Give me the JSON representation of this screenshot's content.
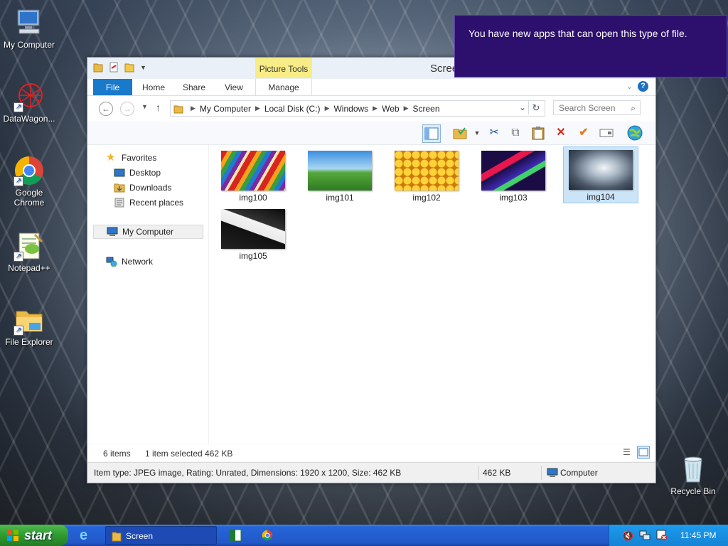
{
  "desktop": {
    "icons": [
      {
        "label": "My Computer"
      },
      {
        "label": "DataWagon..."
      },
      {
        "label": "Google Chrome"
      },
      {
        "label": "Notepad++"
      },
      {
        "label": "File Explorer"
      },
      {
        "label": "Recycle Bin"
      }
    ]
  },
  "window": {
    "title": "Screen",
    "context_tab": "Picture Tools",
    "tabs": [
      "File",
      "Home",
      "Share",
      "View",
      "Manage"
    ],
    "help": "?",
    "address": {
      "segments": [
        "My Computer",
        "Local Disk (C:)",
        "Windows",
        "Web",
        "Screen"
      ]
    },
    "search_placeholder": "Search Screen",
    "nav": {
      "favorites": "Favorites",
      "desktop": "Desktop",
      "downloads": "Downloads",
      "recent": "Recent places",
      "computer": "My Computer",
      "network": "Network"
    },
    "files": [
      {
        "name": "img100"
      },
      {
        "name": "img101"
      },
      {
        "name": "img102"
      },
      {
        "name": "img103"
      },
      {
        "name": "img104"
      },
      {
        "name": "img105"
      }
    ],
    "status": {
      "count": "6 items",
      "selection": "1 item selected  462 KB"
    },
    "details": {
      "info": "Item type: JPEG image, Rating: Unrated, Dimensions: 1920 x 1200, Size: 462 KB",
      "size": "462 KB",
      "location": "Computer"
    }
  },
  "notification": {
    "text": "You have new apps that can open this type of file."
  },
  "taskbar": {
    "start": "start",
    "open_window": "Screen",
    "clock": "11:45 PM"
  },
  "colors": {
    "ribbon_file": "#1979ca",
    "context_tab": "#f7ec86",
    "toast": "#2d0f6e",
    "selection": "#cce4f7"
  }
}
